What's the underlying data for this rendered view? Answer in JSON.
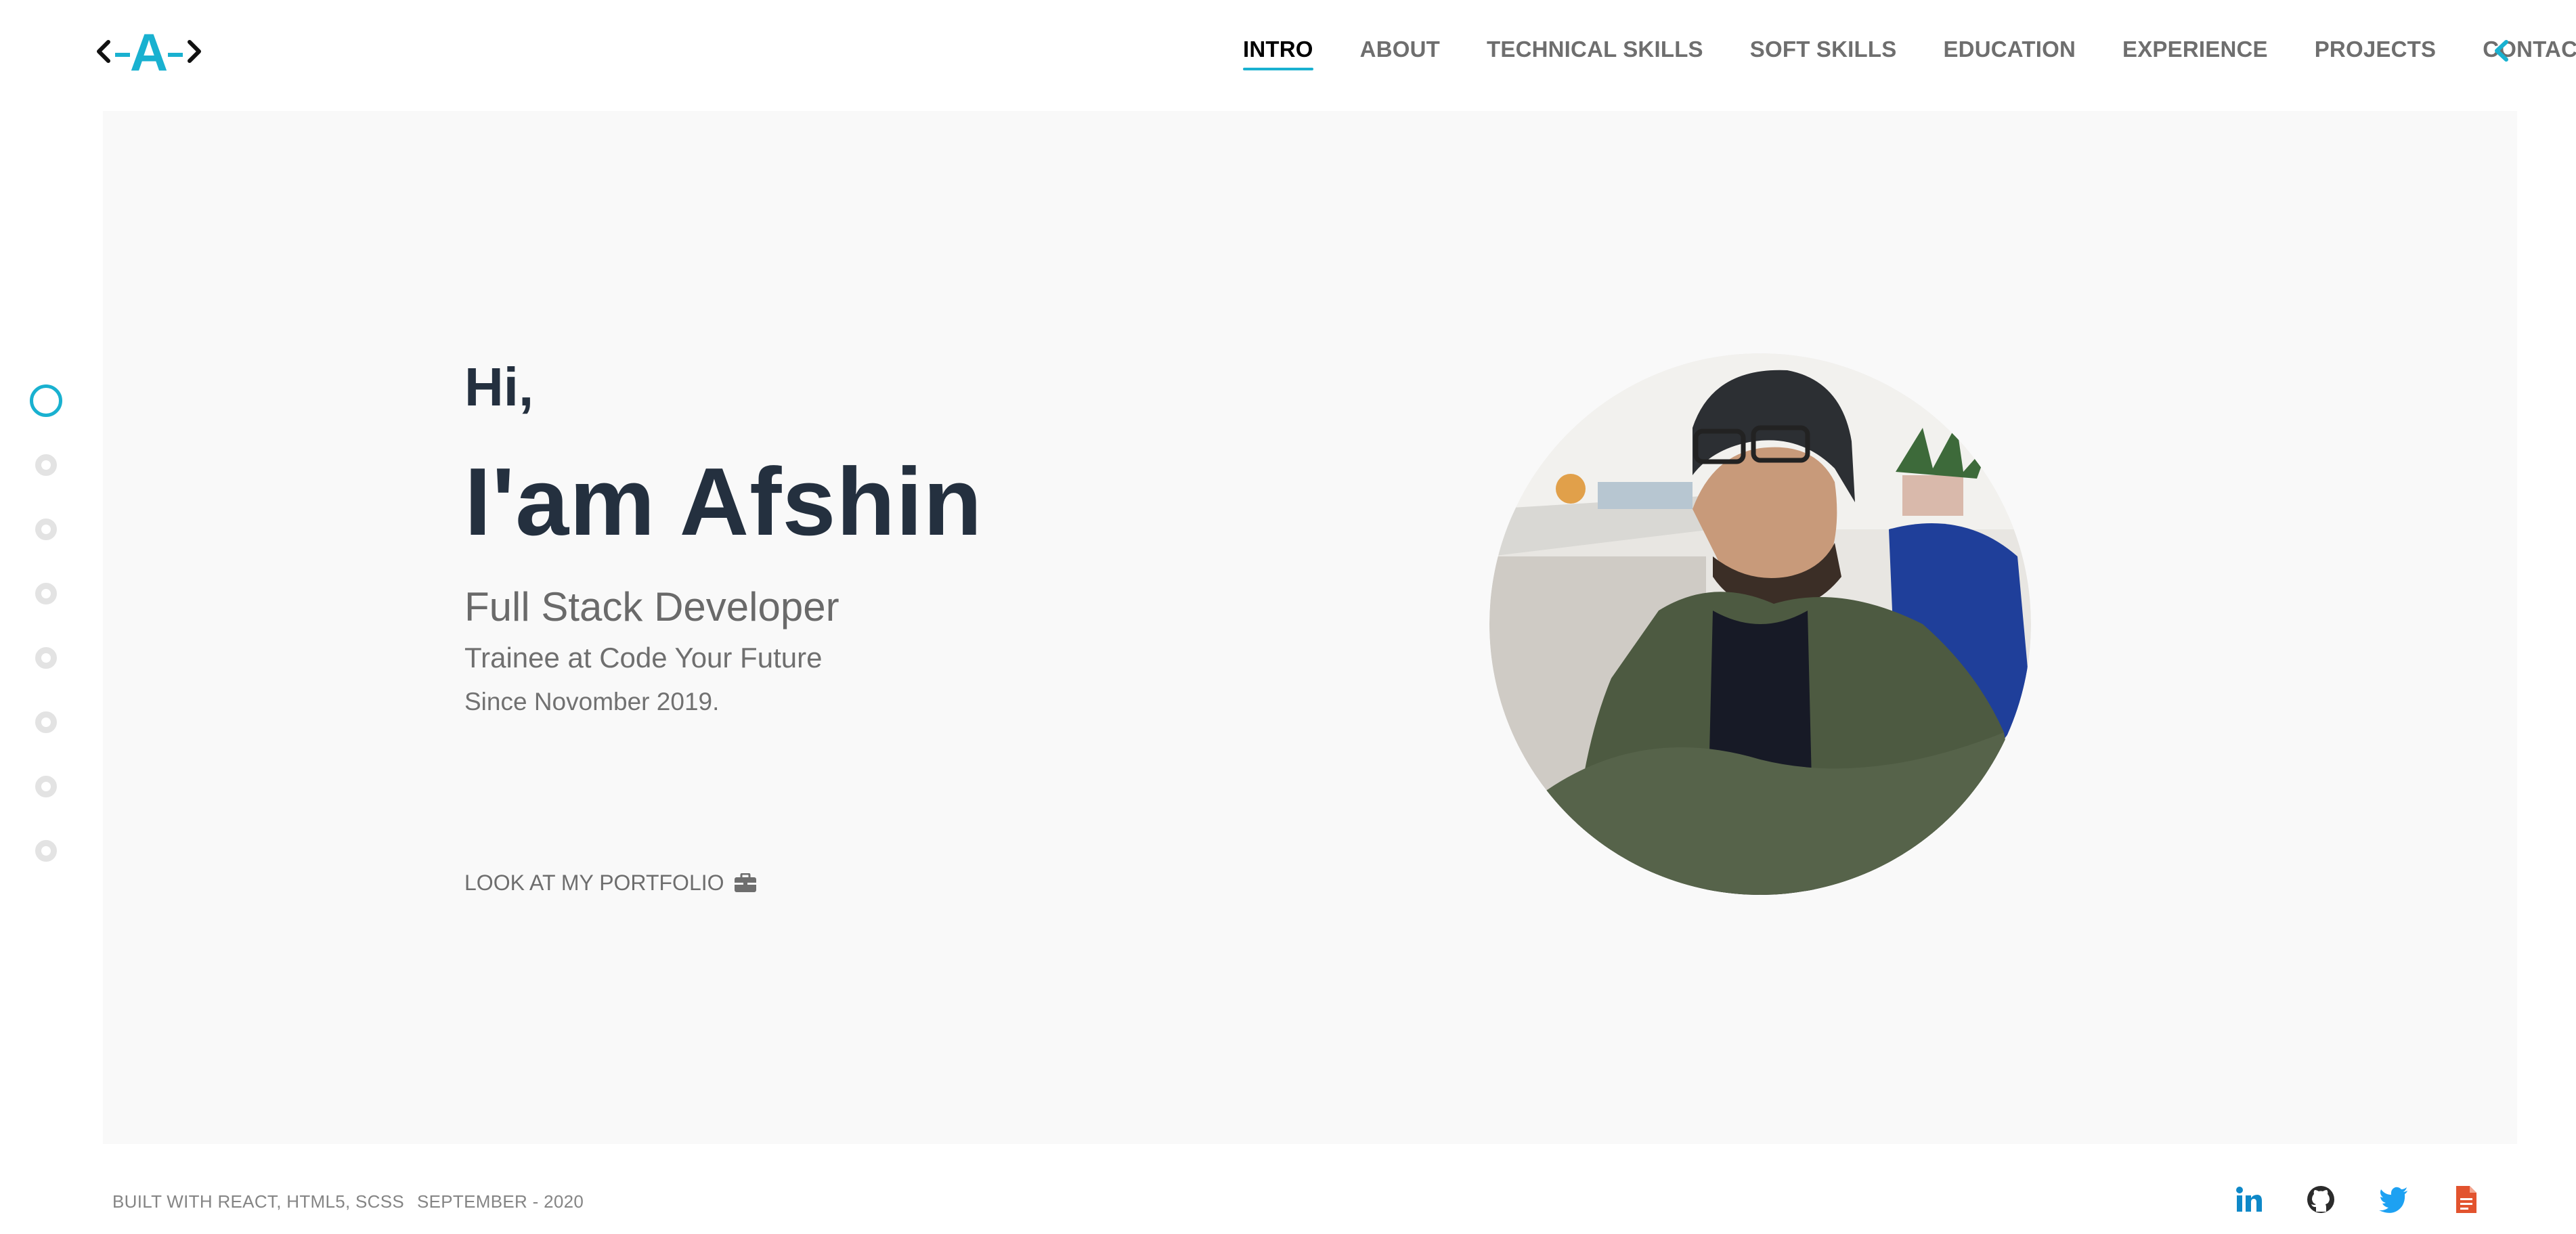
{
  "header": {
    "logo_letter": "A",
    "nav": [
      {
        "label": "INTRO",
        "active": true
      },
      {
        "label": "ABOUT",
        "active": false
      },
      {
        "label": "TECHNICAL SKILLS",
        "active": false
      },
      {
        "label": "SOFT SKILLS",
        "active": false
      },
      {
        "label": "EDUCATION",
        "active": false
      },
      {
        "label": "EXPERIENCE",
        "active": false
      },
      {
        "label": "PROJECTS",
        "active": false
      },
      {
        "label": "CONTACT",
        "active": false
      }
    ],
    "toggle_icon": "chevron-left-icon"
  },
  "hero": {
    "greeting": "Hi,",
    "name": "I'am Afshin",
    "role": "Full Stack Developer",
    "subtitle": "Trainee at Code Your Future",
    "since": "Since Novomber 2019.",
    "cta_label": "LOOK AT MY PORTFOLIO",
    "cta_icon": "briefcase-icon",
    "photo": "profile-photo"
  },
  "section_dots": {
    "count": 8,
    "active_index": 0
  },
  "footer": {
    "built_with": "BUILT WITH REACT, HTML5, SCSS",
    "date": "SEPTEMBER - 2020",
    "social": [
      {
        "icon": "linkedin-icon",
        "color": "#0e88c8"
      },
      {
        "icon": "github-icon",
        "color": "#2b2b2b"
      },
      {
        "icon": "twitter-icon",
        "color": "#1da1f2"
      },
      {
        "icon": "resume-document-icon",
        "color": "#e2532e"
      }
    ]
  },
  "colors": {
    "accent": "#19b1d0",
    "heading": "#24303f",
    "text_muted": "#6e6e6e",
    "hero_background": "#f9f9f9"
  }
}
